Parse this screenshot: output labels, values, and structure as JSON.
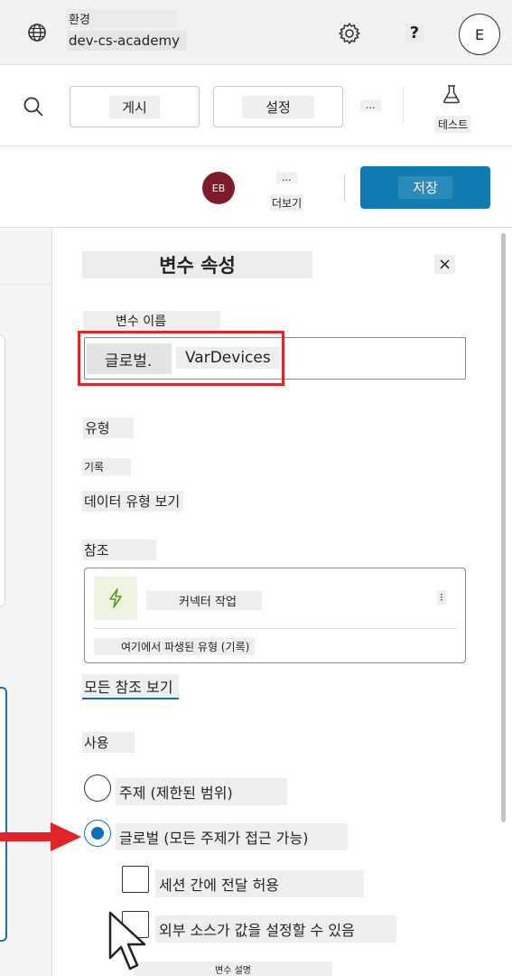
{
  "topbar": {
    "env_label": "환경",
    "env_name": "dev-cs-academy",
    "help": "?",
    "avatar": "E",
    "icons": [
      "globe-icon",
      "gear-icon"
    ]
  },
  "commandbar": {
    "publish_label": "게시",
    "settings_label": "설정",
    "more_dots": "...",
    "test_label": "테스트",
    "icons": [
      "search-icon",
      "flask-icon"
    ]
  },
  "savebar": {
    "user_initials": "EB",
    "more_dots": "...",
    "more_label": "더보기",
    "save_label": "저장"
  },
  "panel": {
    "title": "변수 속성",
    "close": "×",
    "variable_name_label": "변수 이름",
    "name_prefix": "글로벌.",
    "name_value": "VarDevices",
    "type_heading": "유형",
    "type_value": "기록",
    "view_data_type": "데이터 유형 보기",
    "reference_heading": "참조",
    "reference_item": "커넥터 작업",
    "reference_dot": "⁝",
    "reference_sub": "여기에서 파생된 유형 (기록)",
    "view_all_refs": "모든 참조 보기",
    "usage_heading": "사용",
    "scope_topic": "주제 (제한된 범위)",
    "scope_global": "글로벌 (모든 주제가 접근 가능)",
    "scope_selected": "global",
    "option_carry": "세션 간에 전달 허용",
    "option_external": "외부 소스가 값을 설정할 수 있음",
    "description_label": "변수 설명"
  },
  "colors": {
    "save_button": "#0f7bb0",
    "avatar_eb": "#7d1b2a",
    "highlight_red": "#e0242a",
    "radio_selected": "#0f6cbd",
    "flash_icon": "#5b9a1e"
  }
}
